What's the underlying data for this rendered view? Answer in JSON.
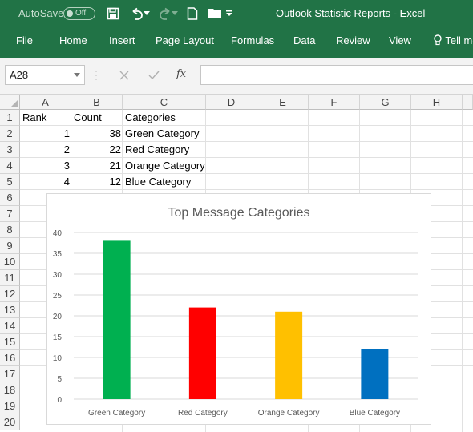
{
  "titlebar": {
    "autosave_label": "AutoSave",
    "autosave_state": "Off",
    "window_title": "Outlook Statistic Reports  -  Excel",
    "icons": [
      "save-icon",
      "undo-icon",
      "redo-icon",
      "new-file-icon",
      "open-folder-icon"
    ]
  },
  "ribbon": {
    "tabs": [
      "File",
      "Home",
      "Insert",
      "Page Layout",
      "Formulas",
      "Data",
      "Review",
      "View"
    ],
    "tell_me": "Tell me"
  },
  "formula_bar": {
    "name_box": "A28",
    "fx_label": "fx",
    "formula": ""
  },
  "grid": {
    "columns": [
      "A",
      "B",
      "C",
      "D",
      "E",
      "F",
      "G",
      "H"
    ],
    "rows": [
      "1",
      "2",
      "3",
      "4",
      "5",
      "6",
      "7",
      "8",
      "9",
      "10",
      "11",
      "12",
      "13",
      "14",
      "15",
      "16",
      "17",
      "18",
      "19",
      "20"
    ],
    "headers": [
      "Rank",
      "Count",
      "Categories"
    ],
    "data": [
      {
        "rank": "1",
        "count": "38",
        "category": "Green Category"
      },
      {
        "rank": "2",
        "count": "22",
        "category": "Red Category"
      },
      {
        "rank": "3",
        "count": "21",
        "category": "Orange Category"
      },
      {
        "rank": "4",
        "count": "12",
        "category": "Blue Category"
      }
    ]
  },
  "chart_data": {
    "type": "bar",
    "title": "Top Message Categories",
    "categories": [
      "Green Category",
      "Red Category",
      "Orange Category",
      "Blue Category"
    ],
    "values": [
      38,
      22,
      21,
      12
    ],
    "colors": [
      "#00b050",
      "#ff0000",
      "#ffc000",
      "#0070c0"
    ],
    "ylim": [
      0,
      40
    ],
    "yticks": [
      "0",
      "5",
      "10",
      "15",
      "20",
      "25",
      "30",
      "35",
      "40"
    ],
    "grid": true,
    "legend": "none",
    "xlabel": "",
    "ylabel": ""
  }
}
